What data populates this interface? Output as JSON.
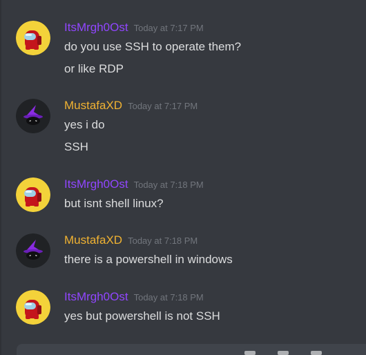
{
  "colors": {
    "background": "#36393f",
    "user1": "#9146ff",
    "user2": "#f0b232",
    "message_text": "#dcddde",
    "timestamp": "#72767d"
  },
  "messages": [
    {
      "username": "ItsMrgh0Ost",
      "timestamp": "Today at 7:17 PM",
      "avatar_icon": "among-us-red-crewmate-icon",
      "lines": [
        "do you use SSH to operate them?",
        "or like RDP"
      ]
    },
    {
      "username": "MustafaXD",
      "timestamp": "Today at 7:17 PM",
      "avatar_icon": "purple-wizard-hat-icon",
      "lines": [
        "yes i do",
        "SSH"
      ]
    },
    {
      "username": "ItsMrgh0Ost",
      "timestamp": "Today at 7:18 PM",
      "avatar_icon": "among-us-red-crewmate-icon",
      "lines": [
        "but isnt shell linux?"
      ]
    },
    {
      "username": "MustafaXD",
      "timestamp": "Today at 7:18 PM",
      "avatar_icon": "purple-wizard-hat-icon",
      "lines": [
        "there is a powershell in windows"
      ]
    },
    {
      "username": "ItsMrgh0Ost",
      "timestamp": "Today at 7:18 PM",
      "avatar_icon": "among-us-red-crewmate-icon",
      "lines": [
        "yes but powershell is not SSH"
      ]
    }
  ]
}
